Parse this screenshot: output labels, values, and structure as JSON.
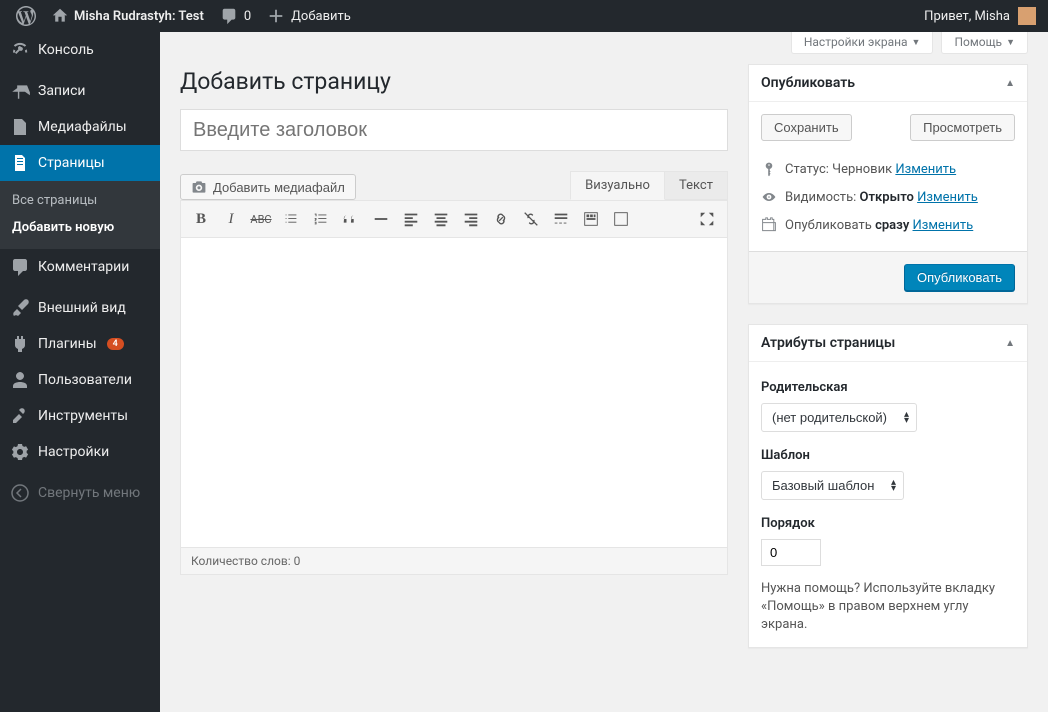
{
  "adminbar": {
    "site_title": "Misha Rudrastyh: Test",
    "comment_count": "0",
    "add_new": "Добавить",
    "greeting": "Привет, Misha"
  },
  "sidebar": {
    "items": [
      {
        "label": "Консоль"
      },
      {
        "label": "Записи"
      },
      {
        "label": "Медиафайлы"
      },
      {
        "label": "Страницы"
      },
      {
        "label": "Комментарии"
      },
      {
        "label": "Внешний вид"
      },
      {
        "label": "Плагины",
        "badge": "4"
      },
      {
        "label": "Пользователи"
      },
      {
        "label": "Инструменты"
      },
      {
        "label": "Настройки"
      }
    ],
    "pages_submenu": [
      {
        "label": "Все страницы"
      },
      {
        "label": "Добавить новую"
      }
    ],
    "collapse": "Свернуть меню"
  },
  "screen_meta": {
    "options": "Настройки экрана",
    "help": "Помощь"
  },
  "page": {
    "heading": "Добавить страницу",
    "title_placeholder": "Введите заголовок",
    "add_media": "Добавить медиафайл",
    "tab_visual": "Визуально",
    "tab_text": "Текст",
    "word_count": "Количество слов: 0"
  },
  "publish": {
    "box_title": "Опубликовать",
    "save_draft": "Сохранить",
    "preview": "Просмотреть",
    "status_label": "Статус:",
    "status_value": "Черновик",
    "visibility_label": "Видимость:",
    "visibility_value": "Открыто",
    "schedule_label": "Опубликовать",
    "schedule_value": "сразу",
    "edit": "Изменить",
    "publish_btn": "Опубликовать"
  },
  "attributes": {
    "box_title": "Атрибуты страницы",
    "parent_label": "Родительская",
    "parent_value": "(нет родительской)",
    "template_label": "Шаблон",
    "template_value": "Базовый шаблон",
    "order_label": "Порядок",
    "order_value": "0",
    "help_text": "Нужна помощь? Используйте вкладку «Помощь» в правом верхнем углу экрана."
  }
}
